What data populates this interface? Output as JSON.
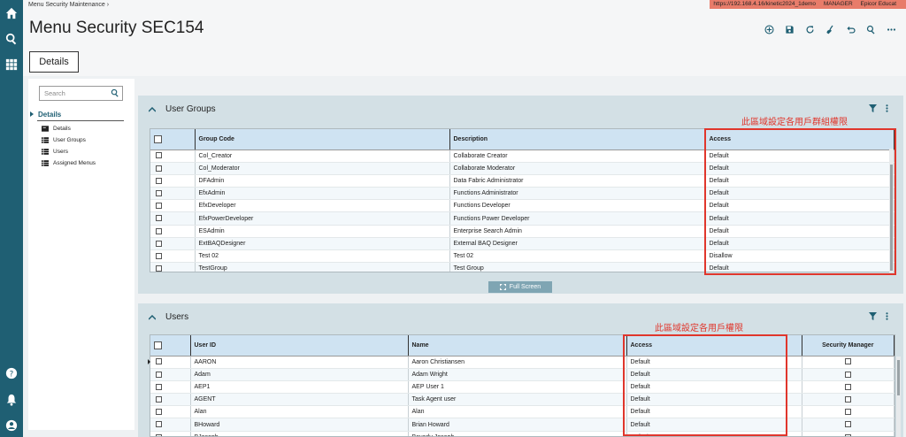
{
  "breadcrumb": "Menu Security Maintenance",
  "urlbar": {
    "url": "https://192.168.4.16/kinetic2024_1demo",
    "user": "MANAGER",
    "company": "Epicor Educat"
  },
  "page_title": "Menu Security SEC154",
  "details_tab": "Details",
  "sidenav": {
    "search_placeholder": "Search",
    "section": "Details",
    "items": [
      "Details",
      "User Groups",
      "Users",
      "Assigned Menus"
    ]
  },
  "user_groups": {
    "title": "User Groups",
    "annotation": "此區域設定各用戶群組權限",
    "columns": [
      "Group Code",
      "Description",
      "Access"
    ],
    "rows": [
      [
        "Col_Creator",
        "Collaborate Creator",
        "Default"
      ],
      [
        "Col_Moderator",
        "Collaborate Moderator",
        "Default"
      ],
      [
        "DFAdmin",
        "Data Fabric Administrator",
        "Default"
      ],
      [
        "EfxAdmin",
        "Functions Administrator",
        "Default"
      ],
      [
        "EfxDeveloper",
        "Functions Developer",
        "Default"
      ],
      [
        "EfxPowerDeveloper",
        "Functions Power Developer",
        "Default"
      ],
      [
        "ESAdmin",
        "Enterprise Search Admin",
        "Default"
      ],
      [
        "ExtBAQDesigner",
        "External BAQ Designer",
        "Default"
      ],
      [
        "Test 02",
        "Test 02",
        "Disallow"
      ],
      [
        "TestGroup",
        "Test Group",
        "Default"
      ]
    ],
    "full_screen": "Full Screen"
  },
  "users": {
    "title": "Users",
    "annotation": "此區域設定各用戶權限",
    "columns": [
      "User ID",
      "Name",
      "Access",
      "Security Manager"
    ],
    "rows": [
      [
        "AARON",
        "Aaron Christiansen",
        "Default",
        false
      ],
      [
        "Adam",
        "Adam Wright",
        "Default",
        false
      ],
      [
        "AEP1",
        "AEP User 1",
        "Default",
        false
      ],
      [
        "AGENT",
        "Task Agent user",
        "Default",
        false
      ],
      [
        "Alan",
        "Alan",
        "Default",
        false
      ],
      [
        "BHoward",
        "Brian Howard",
        "Default",
        false
      ],
      [
        "BJoseph",
        "Beverly Joseph",
        "Default",
        true
      ]
    ]
  },
  "colors": {
    "rail": "#1f5f73",
    "accent": "#1f5f73",
    "annotation": "#e0362c",
    "header_cell": "#cfe3f2"
  }
}
